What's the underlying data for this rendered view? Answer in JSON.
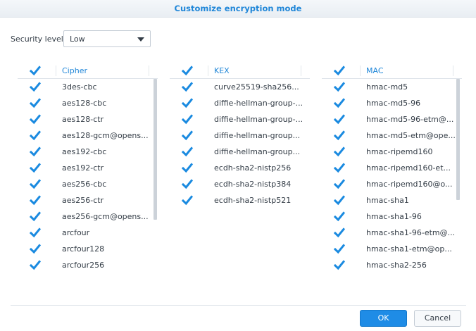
{
  "dialog": {
    "title": "Customize encryption mode"
  },
  "security": {
    "label": "Security level:",
    "value": "Low"
  },
  "panels": [
    {
      "header": "Cipher",
      "items": [
        "3des-cbc",
        "aes128-cbc",
        "aes128-ctr",
        "aes128-gcm@opens...",
        "aes192-cbc",
        "aes192-ctr",
        "aes256-cbc",
        "aes256-ctr",
        "aes256-gcm@opens...",
        "arcfour",
        "arcfour128",
        "arcfour256"
      ]
    },
    {
      "header": "KEX",
      "items": [
        "curve25519-sha256...",
        "diffie-hellman-group-...",
        "diffie-hellman-group-...",
        "diffie-hellman-group...",
        "diffie-hellman-group...",
        "ecdh-sha2-nistp256",
        "ecdh-sha2-nistp384",
        "ecdh-sha2-nistp521"
      ]
    },
    {
      "header": "MAC",
      "items": [
        "hmac-md5",
        "hmac-md5-96",
        "hmac-md5-96-etm@...",
        "hmac-md5-etm@ope...",
        "hmac-ripemd160",
        "hmac-ripemd160-et...",
        "hmac-ripemd160@o...",
        "hmac-sha1",
        "hmac-sha1-96",
        "hmac-sha1-96-etm@...",
        "hmac-sha1-etm@op...",
        "hmac-sha2-256"
      ]
    }
  ],
  "buttons": {
    "ok": "OK",
    "cancel": "Cancel"
  },
  "colors": {
    "accent": "#1f86d8",
    "check": "#1a8ae0",
    "ok_bg": "#1f8ce6"
  }
}
